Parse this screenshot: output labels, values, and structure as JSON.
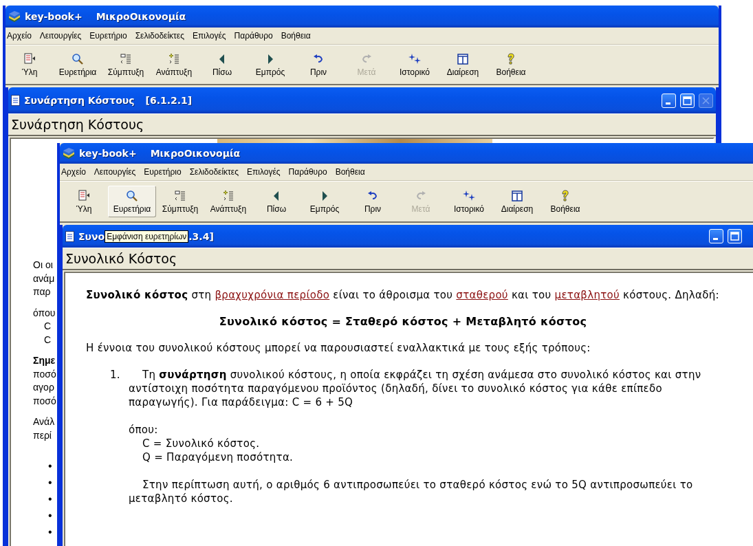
{
  "back_window": {
    "app_name": "key-book+",
    "document_name": "ΜικροΟικονομία",
    "menu": [
      "Αρχείο",
      "Λειτουργίες",
      "Ευρετήριο",
      "Σελιδοδείκτες",
      "Επιλογές",
      "Παράθυρο",
      "Βοήθεια"
    ],
    "toolbar": [
      {
        "label": "Ύλη",
        "disabled": false,
        "selected": false
      },
      {
        "label": "Ευρετήρια",
        "disabled": false,
        "selected": false
      },
      {
        "label": "Σύμπτυξη",
        "disabled": false,
        "selected": false
      },
      {
        "label": "Ανάπτυξη",
        "disabled": false,
        "selected": false
      },
      {
        "label": "Πίσω",
        "disabled": false,
        "selected": false
      },
      {
        "label": "Εμπρός",
        "disabled": false,
        "selected": false
      },
      {
        "label": "Πριν",
        "disabled": false,
        "selected": false
      },
      {
        "label": "Μετά",
        "disabled": true,
        "selected": false
      },
      {
        "label": "Ιστορικό",
        "disabled": false,
        "selected": false
      },
      {
        "label": "Διαίρεση",
        "disabled": false,
        "selected": false
      },
      {
        "label": "Βοήθεια",
        "disabled": false,
        "selected": false
      }
    ],
    "topic": {
      "title": "Συνάρτηση Κόστους",
      "section": "[6.1.2.1]",
      "close_disabled": true,
      "heading": "Συνάρτηση Κόστους",
      "blocks": [
        {
          "kind": "text",
          "lines": [
            {
              "text": "Οι οι",
              "bold": false
            },
            {
              "text": "ανάμ",
              "bold": false
            },
            {
              "text": "παρ",
              "bold": false
            }
          ]
        },
        {
          "kind": "text",
          "lines": [
            {
              "text": "όπου",
              "bold": false,
              "children": [
                {
                  "text": "C",
                  "bold": false
                },
                {
                  "text": "C",
                  "bold": false
                }
              ]
            }
          ]
        },
        {
          "kind": "text",
          "lines": [
            {
              "text": "Σημε",
              "bold": true
            },
            {
              "text": "ποσό",
              "bold": false
            },
            {
              "text": "αγορ",
              "bold": false
            },
            {
              "text": "ποσό",
              "bold": false
            }
          ]
        },
        {
          "kind": "text",
          "lines": [
            {
              "text": "Ανάλ",
              "bold": false
            },
            {
              "text": "περί",
              "bold": false
            }
          ]
        },
        {
          "kind": "bullets",
          "items": [
            "•",
            "•",
            "•",
            "•",
            "•"
          ]
        }
      ]
    }
  },
  "front_window": {
    "app_name": "key-book+",
    "document_name": "ΜικροΟικονομία",
    "menu": [
      "Αρχείο",
      "Λειτουργίες",
      "Ευρετήριο",
      "Σελιδοδείκτες",
      "Επιλογές",
      "Παράθυρο",
      "Βοήθεια"
    ],
    "toolbar": [
      {
        "label": "Ύλη",
        "disabled": false,
        "selected": false
      },
      {
        "label": "Ευρετήρια",
        "disabled": false,
        "selected": true
      },
      {
        "label": "Σύμπτυξη",
        "disabled": false,
        "selected": false
      },
      {
        "label": "Ανάπτυξη",
        "disabled": false,
        "selected": false
      },
      {
        "label": "Πίσω",
        "disabled": false,
        "selected": false
      },
      {
        "label": "Εμπρός",
        "disabled": false,
        "selected": false
      },
      {
        "label": "Πριν",
        "disabled": false,
        "selected": false
      },
      {
        "label": "Μετά",
        "disabled": true,
        "selected": false
      },
      {
        "label": "Ιστορικό",
        "disabled": false,
        "selected": false
      },
      {
        "label": "Διαίρεση",
        "disabled": false,
        "selected": false
      },
      {
        "label": "Βοήθεια",
        "disabled": false,
        "selected": false
      }
    ],
    "topic": {
      "title_start": "Συνο",
      "tooltip": "Εμφάνιση ευρετηρίων",
      "title_end": ".3.4]",
      "heading": "Συνολικό Κόστος",
      "blocks": [
        {
          "kind": "paragraph",
          "segments": [
            {
              "kind": "bold",
              "text": "Συνολικό κόστος"
            },
            {
              "kind": "plain",
              "text": " στη "
            },
            {
              "kind": "link",
              "text": "βραχυχρόνια περίοδο"
            },
            {
              "kind": "plain",
              "text": " είναι το άθροισμα του "
            },
            {
              "kind": "link",
              "text": "σταθερού"
            },
            {
              "kind": "plain",
              "text": " και του "
            },
            {
              "kind": "link",
              "text": "μεταβλητού"
            },
            {
              "kind": "plain",
              "text": " κόστους. Δηλαδή:"
            }
          ]
        },
        {
          "kind": "formula",
          "text": "Συνολικό κόστος = Σταθερό κόστος + Μεταβλητό κόστος"
        },
        {
          "kind": "plain",
          "text": "Η έννοια του συνολικού κόστους μπορεί να παρουσιαστεί εναλλακτικά με τους εξής τρόπους:"
        },
        {
          "kind": "numbered",
          "number": "1.",
          "text": "Τη **συνάρτηση** συνολικού κόστους, η οποία εκφράζει τη σχέση ανάμεσα στο συνολικό κόστος και στην αντίστοιχη ποσότητα παραγόμενου προϊόντος (δηλαδή, δίνει το συνολικό κόστος για κάθε επίπεδο παραγωγής). Για παράδειγμα:    C = 6 + 5Q",
          "children": [
            {
              "kind": "where",
              "lines": [
                "όπου:",
                "C = Συνολικό κόστος.",
                "Q = Παραγόμενη ποσότητα."
              ]
            },
            {
              "kind": "note",
              "text": "Στην περίπτωση αυτή, ο αριθμός 6 αντιπροσωπεύει το σταθερό κόστος ενώ το 5Q αντιπροσωπεύει το μεταβλητό κόστος."
            }
          ]
        }
      ]
    }
  }
}
